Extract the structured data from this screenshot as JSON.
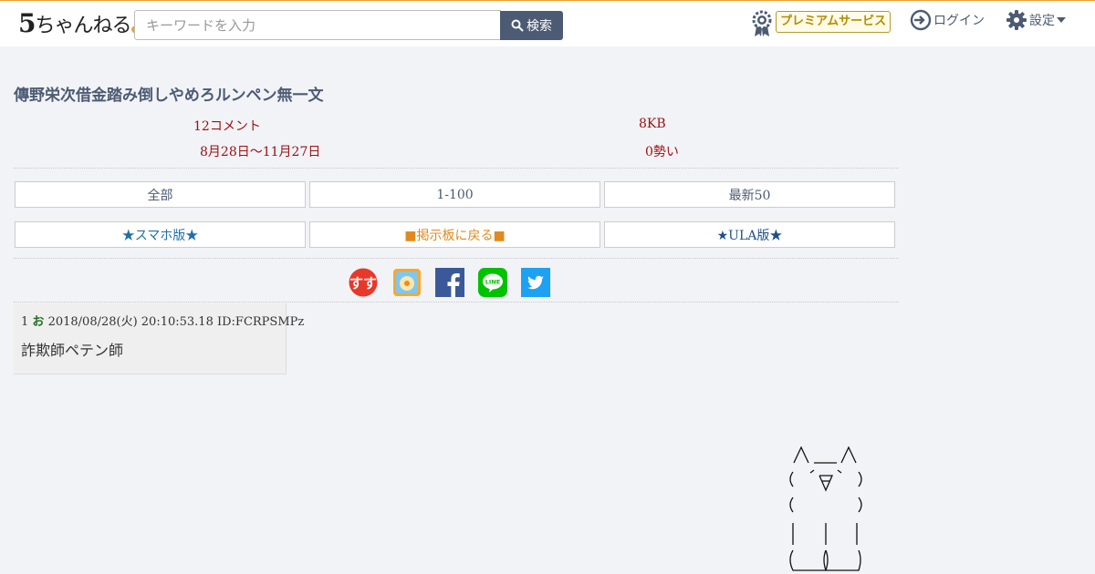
{
  "header": {
    "logo_main": "5",
    "logo_text": "ちゃんねる",
    "search_placeholder": "キーワードを入力",
    "search_label": "検索",
    "premium_label": "プレミアムサービス",
    "login_label": "ログイン",
    "settings_label": "設定"
  },
  "thread": {
    "title": "傳野栄次借金踏み倒しやめろルンペン無一文",
    "comments": "12コメント",
    "size": "8KB",
    "date_range": "8月28日〜11月27日",
    "momentum": "0勢い"
  },
  "nav": {
    "all": "全部",
    "range": "1-100",
    "latest": "最新50",
    "smartphone": "★スマホ版★",
    "back": "■掲示板に戻る■",
    "ula": "★ULA版★"
  },
  "post": {
    "number": "1",
    "name": "お",
    "datetime": "2018/08/28(火) 20:10:53.18",
    "id": "ID:FCRPSMPz",
    "body": "詐欺師ペテン師"
  },
  "social": {
    "sumaho_text": "すす"
  },
  "colors": {
    "header_accent": "#f0a030",
    "title": "#4c5b73",
    "meta": "#a01010",
    "name": "#207020",
    "facebook": "#3b5998",
    "line": "#00c300",
    "twitter": "#1da1f2"
  }
}
